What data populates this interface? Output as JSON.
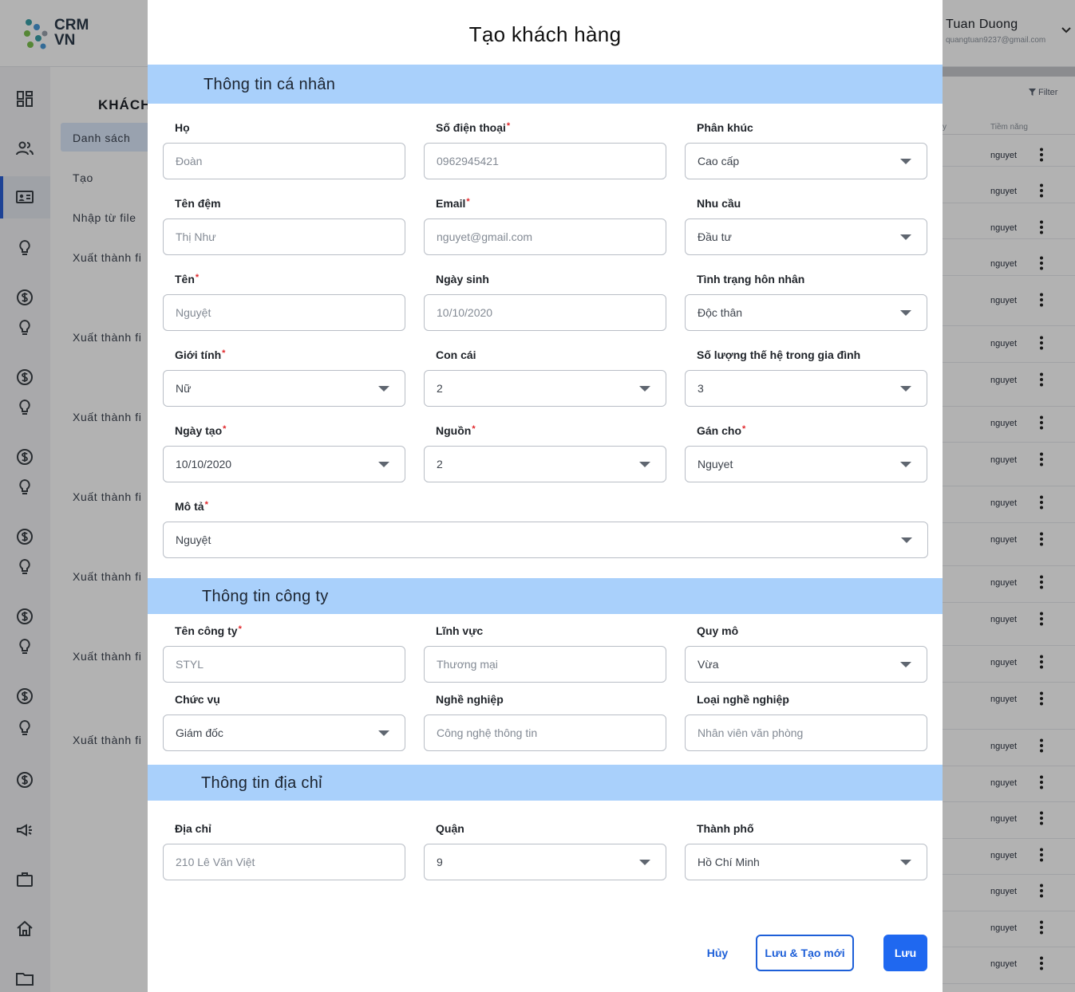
{
  "app": {
    "logo_text_line1": "CRM",
    "logo_text_line2": "VN",
    "user_name": "Tuan Duong",
    "user_email": "quangtuan9237@gmail.com"
  },
  "subnav": {
    "title": "KHÁCH",
    "items": [
      "Danh sách",
      "Tạo",
      "Nhập từ file",
      "Xuất thành fi",
      "Xuất thành fi",
      "Xuất thành fi",
      "Xuất thành fi",
      "Xuất thành fi",
      "Xuất thành fi",
      "Xuất thành fi"
    ]
  },
  "rail_icons": [
    "dashboard-icon",
    "users-icon",
    "contact-card-icon",
    "bulb-icon",
    "dollar-icon",
    "bulb-icon",
    "dollar-icon",
    "bulb-icon",
    "dollar-icon",
    "bulb-icon",
    "dollar-icon",
    "bulb-icon",
    "dollar-icon",
    "bulb-icon",
    "dollar-icon",
    "bulb-icon",
    "dollar-icon",
    "megaphone-icon",
    "briefcase-icon",
    "home-icon",
    "folder-icon"
  ],
  "table": {
    "filter_label": "Filter",
    "col_partial": "y",
    "col_potential": "Tiềm năng",
    "row_value": "nguyet",
    "row_count": 23
  },
  "modal": {
    "title": "Tạo khách hàng",
    "sections": {
      "personal": "Thông tin cá nhân",
      "company": "Thông tin công ty",
      "address": "Thông tin địa chỉ"
    },
    "fields": {
      "ho": {
        "label": "Họ",
        "placeholder": "Đoàn"
      },
      "phone": {
        "label": "Số điện thoại",
        "placeholder": "0962945421"
      },
      "segment": {
        "label": "Phân khúc",
        "value": "Cao cấp"
      },
      "middle": {
        "label": "Tên đệm",
        "placeholder": "Thị Như"
      },
      "email": {
        "label": "Email",
        "placeholder": "nguyet@gmail.com"
      },
      "need": {
        "label": "Nhu cầu",
        "value": "Đầu tư"
      },
      "name": {
        "label": "Tên",
        "placeholder": "Nguyệt"
      },
      "birthday": {
        "label": "Ngày sinh",
        "placeholder": "10/10/2020"
      },
      "marital": {
        "label": "Tình trạng hôn nhân",
        "value": "Độc thân"
      },
      "gender": {
        "label": "Giới tính",
        "value": "Nữ"
      },
      "children": {
        "label": "Con cái",
        "value": "2"
      },
      "generations": {
        "label": "Số lượng thế hệ trong gia đình",
        "value": "3"
      },
      "created": {
        "label": "Ngày tạo",
        "value": "10/10/2020"
      },
      "source": {
        "label": "Nguồn",
        "value": "2"
      },
      "assign": {
        "label": "Gán cho",
        "value": "Nguyet"
      },
      "desc": {
        "label": "Mô tả",
        "value": "Nguyệt"
      },
      "company_name": {
        "label": "Tên công ty",
        "placeholder": "STYL"
      },
      "field": {
        "label": "Lĩnh vực",
        "placeholder": "Thương mại"
      },
      "scale": {
        "label": "Quy mô",
        "value": "Vừa"
      },
      "position": {
        "label": "Chức vụ",
        "value": "Giám đốc"
      },
      "job": {
        "label": "Nghề nghiệp",
        "placeholder": "Công nghệ thông tin"
      },
      "job_type": {
        "label": "Loại nghề nghiệp",
        "placeholder": "Nhân viên văn phòng"
      },
      "address": {
        "label": "Địa chỉ",
        "placeholder": "210 Lê Văn Việt"
      },
      "district": {
        "label": "Quận",
        "value": "9"
      },
      "city": {
        "label": "Thành phố",
        "value": "Hồ Chí Minh"
      }
    },
    "buttons": {
      "cancel": "Hủy",
      "save_new": "Lưu & Tạo mới",
      "save": "Lưu"
    }
  },
  "colors": {
    "section_bg": "#a9d0fb",
    "primary": "#1f68f0",
    "required": "#e0262a"
  }
}
